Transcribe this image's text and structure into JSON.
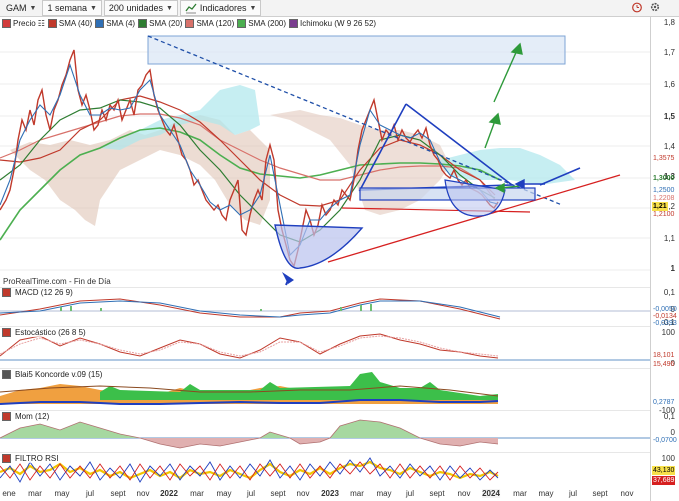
{
  "toolbar": {
    "symbol": "GAM",
    "period": "1 semana",
    "units": "200 unidades",
    "indicators": "Indicadores"
  },
  "legend": [
    {
      "label": "Precio",
      "color": "#d23b3b"
    },
    {
      "label": "SMA (40)",
      "color": "#c0392b"
    },
    {
      "label": "SMA (4)",
      "color": "#2f6fb5"
    },
    {
      "label": "SMA (20)",
      "color": "#2e7d32"
    },
    {
      "label": "SMA (120)",
      "color": "#d8716a"
    },
    {
      "label": "SMA (200)",
      "color": "#4caf50"
    },
    {
      "label": "Ichimoku (W 9 26 52)",
      "color": "#7a3d8f"
    }
  ],
  "source_label": "ProRealTime.com - Fin de Día",
  "price_axis": [
    "1,8",
    "1,7",
    "1,6",
    "1,5",
    "1,4",
    "1,3",
    "1,2",
    "1,1",
    "1"
  ],
  "price_tags": [
    {
      "text": "1,3575",
      "color": "#c0392b",
      "bg": "#ffffff"
    },
    {
      "text": "1,3000",
      "color": "#2e7d32",
      "bg": "#ffffff"
    },
    {
      "text": "1,2500",
      "color": "#2f6fb5",
      "bg": "#ffffff"
    },
    {
      "text": "1,2208",
      "color": "#d8716a",
      "bg": "#ffffff"
    },
    {
      "text": "1,21",
      "color": "#000000",
      "bg": "#f7e04a"
    },
    {
      "text": "1,2100",
      "color": "#c0392b",
      "bg": "#ffffff"
    }
  ],
  "panels": {
    "macd": {
      "title": "MACD (12 26 9)",
      "axis": [
        "0,1",
        "0",
        "-0,1"
      ],
      "tags": [
        "-0,0050",
        "-0,0134",
        "-0,0393"
      ]
    },
    "stoch": {
      "title": "Estocástico (26 8 5)",
      "axis": [
        "100",
        "0"
      ],
      "tags": [
        "18,101",
        "15,496"
      ]
    },
    "koncorde": {
      "title": "Blai5 Koncorde v.09 (15)",
      "axis": [
        "-100"
      ],
      "tags": [
        "0,2787"
      ]
    },
    "mom": {
      "title": "Mom (12)",
      "axis": [
        "0,1",
        "0"
      ],
      "tags": [
        "-0,0700"
      ]
    },
    "rsi": {
      "title": "FILTRO RSI",
      "axis": [
        "100"
      ],
      "tags": [
        "43,130",
        "37,689"
      ]
    }
  },
  "xaxis": [
    {
      "label": "ene",
      "bold": false
    },
    {
      "label": "mar",
      "bold": false
    },
    {
      "label": "may",
      "bold": false
    },
    {
      "label": "jul",
      "bold": false
    },
    {
      "label": "sept",
      "bold": false
    },
    {
      "label": "nov",
      "bold": false
    },
    {
      "label": "2022",
      "bold": true
    },
    {
      "label": "mar",
      "bold": false
    },
    {
      "label": "may",
      "bold": false
    },
    {
      "label": "jul",
      "bold": false
    },
    {
      "label": "sept",
      "bold": false
    },
    {
      "label": "nov",
      "bold": false
    },
    {
      "label": "2023",
      "bold": true
    },
    {
      "label": "mar",
      "bold": false
    },
    {
      "label": "may",
      "bold": false
    },
    {
      "label": "jul",
      "bold": false
    },
    {
      "label": "sept",
      "bold": false
    },
    {
      "label": "nov",
      "bold": false
    },
    {
      "label": "2024",
      "bold": true
    },
    {
      "label": "mar",
      "bold": false
    },
    {
      "label": "may",
      "bold": false
    },
    {
      "label": "jul",
      "bold": false
    },
    {
      "label": "sept",
      "bold": false
    },
    {
      "label": "nov",
      "bold": false
    }
  ]
}
